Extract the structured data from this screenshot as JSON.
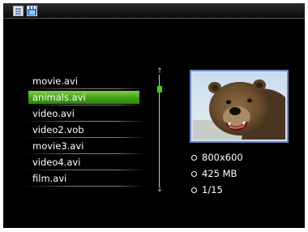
{
  "toolbar": {
    "icons": [
      "document-icon",
      "film-icon"
    ]
  },
  "files": [
    {
      "name": "movie.avi",
      "selected": false
    },
    {
      "name": "animals.avi",
      "selected": true
    },
    {
      "name": "video.avi",
      "selected": false
    },
    {
      "name": "video2.vob",
      "selected": false
    },
    {
      "name": "movie3.avi",
      "selected": false
    },
    {
      "name": "video4.avi",
      "selected": false
    },
    {
      "name": "film.avi",
      "selected": false
    }
  ],
  "scrollbar": {
    "up_glyph": "↑",
    "down_glyph": "↓"
  },
  "preview": {
    "subject": "bear-thumbnail"
  },
  "info": {
    "resolution": "800x600",
    "size": "425 MB",
    "position": "1/15"
  },
  "colors": {
    "background": "#000000",
    "selection_green": "#3f9e14",
    "scroll_thumb": "#46d01c",
    "frame_border": "#6f88c2"
  }
}
